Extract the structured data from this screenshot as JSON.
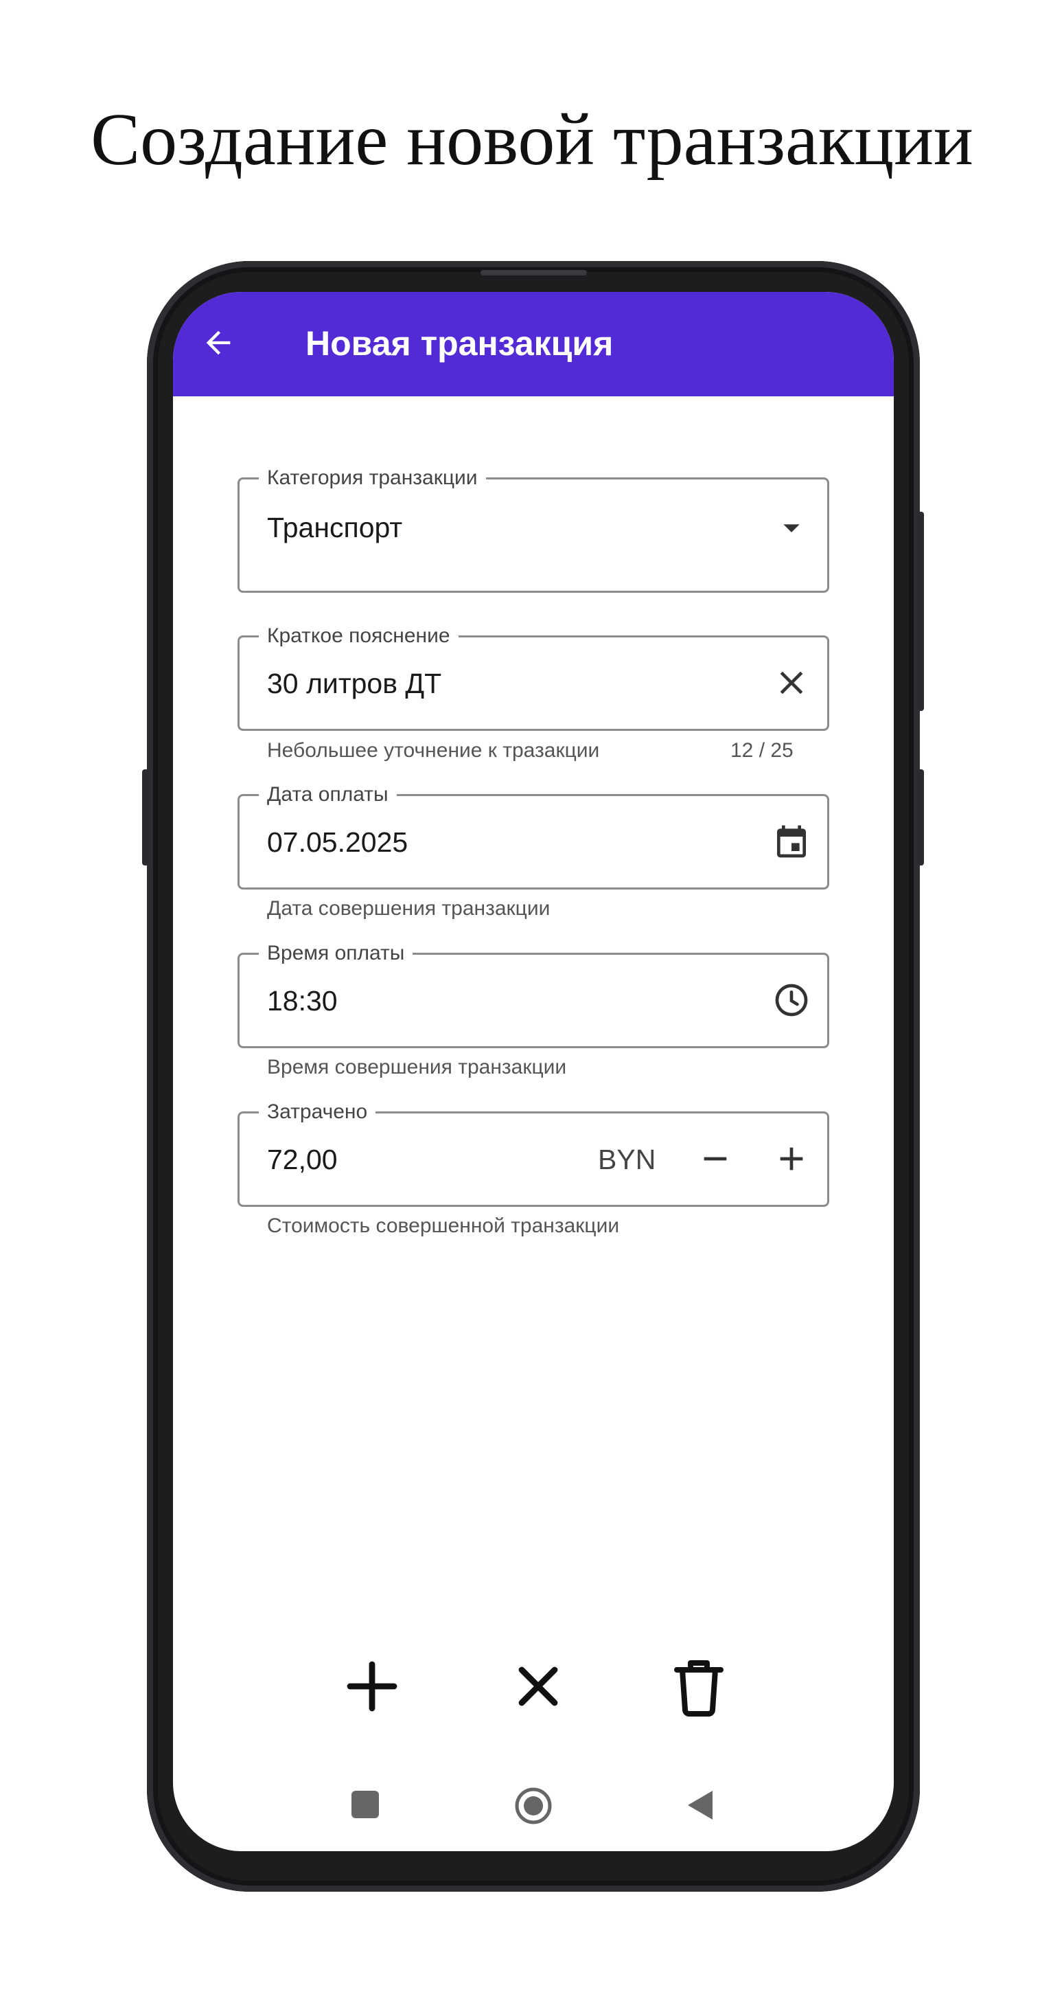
{
  "promo": {
    "title": "Создание новой транзакции"
  },
  "appbar": {
    "title": "Новая транзакция",
    "back_icon": "arrow-back-icon",
    "color": "#522ad6"
  },
  "form": {
    "category": {
      "label": "Категория транзакции",
      "value": "Транспорт",
      "icon": "dropdown-arrow-icon"
    },
    "description": {
      "label": "Краткое пояснение",
      "value": "30 литров ДТ",
      "helper": "Небольшее уточнение к тразакции",
      "counter": "12 / 25",
      "icon": "clear-icon"
    },
    "date": {
      "label": "Дата оплаты",
      "value": "07.05.2025",
      "helper": "Дата совершения транзакции",
      "icon": "calendar-icon"
    },
    "time": {
      "label": "Время оплаты",
      "value": "18:30",
      "helper": "Время совершения транзакции",
      "icon": "clock-icon"
    },
    "amount": {
      "label": "Затрачено",
      "value": "72,00",
      "currency": "BYN",
      "helper": "Стоимость совершенной транзакции",
      "decrement_icon": "minus-icon",
      "increment_icon": "plus-icon"
    }
  },
  "actions": {
    "add_icon": "plus-icon",
    "cancel_icon": "close-icon",
    "delete_icon": "trash-icon"
  },
  "system_nav": {
    "recents_icon": "square-icon",
    "home_icon": "circle-icon",
    "back_icon": "triangle-back-icon"
  }
}
